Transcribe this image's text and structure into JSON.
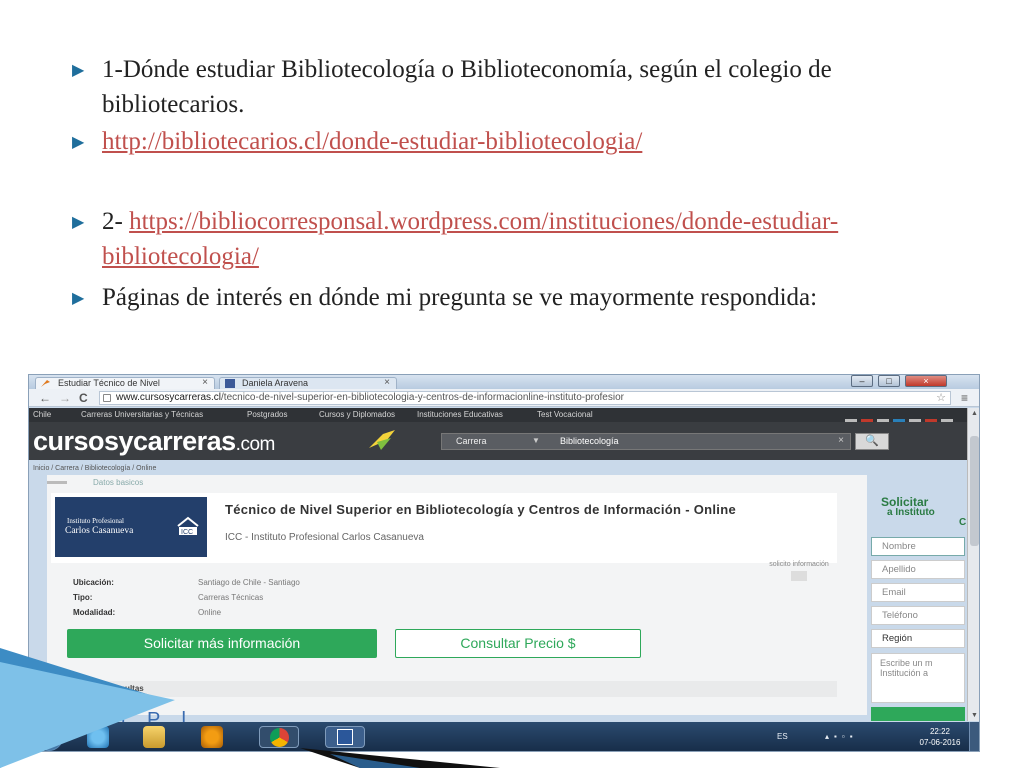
{
  "slide": {
    "bullets": [
      {
        "text": "1-Dónde estudiar Bibliotecología o Biblioteconomía, según el colegio de bibliotecarios."
      },
      {
        "link": "http://bibliotecarios.cl/donde-estudiar-bibliotecologia/"
      },
      {
        "prefix": "2- ",
        "link": "https://bibliocorresponsal.wordpress.com/instituciones/donde-estudiar-bibliotecologia/"
      },
      {
        "text": "Páginas de  interés en dónde mi pregunta se ve mayormente respondida:"
      }
    ],
    "accent_color": "#1f6e9c",
    "link_color": "#c0504d"
  },
  "browser": {
    "tabs": [
      {
        "label": "Estudiar Técnico de Nivel"
      },
      {
        "label": "Daniela Aravena"
      }
    ],
    "close_glyph": "×",
    "controls": {
      "min": "–",
      "max": "□",
      "close": "×"
    },
    "nav": {
      "back": "←",
      "forward": "→",
      "reload": "C"
    },
    "url_host": "www.cursosycarreras.cl",
    "url_path": "/tecnico-de-nivel-superior-en-bibliotecologia-y-centros-de-informacionline-instituto-profesior",
    "star": "☆",
    "menu": "≡"
  },
  "site": {
    "nav_items": [
      "Chile",
      "Carreras Universitarias y Técnicas",
      "Postgrados",
      "Cursos y Diplomados",
      "Instituciones Educativas",
      "Test Vocacional"
    ],
    "logo_main": "cursosycarreras",
    "logo_tld": ".com",
    "search": {
      "select": "Carrera",
      "value": "Bibliotecología",
      "clear": "×",
      "button": "🔍"
    },
    "breadcrumb": "Inicio / Carrera / Bibliotecología / Online",
    "section_tab": "Datos basicos",
    "institution_logo": {
      "line1": "Instituto Profesional",
      "line2": "Carlos Casanueva",
      "mark": "ICC"
    },
    "course_title": "Técnico de Nivel Superior en Bibliotecología y Centros de Información - Online",
    "course_institution": "ICC - Instituto Profesional Carlos Casanueva",
    "details": [
      {
        "label": "Ubicación:",
        "value": "Santiago de Chile - Santiago"
      },
      {
        "label": "Tipo:",
        "value": "Carreras Técnicas"
      },
      {
        "label": "Modalidad:",
        "value": "Online"
      }
    ],
    "request_info": "solicito información",
    "btn_request": "Solicitar más información",
    "btn_price": "Consultar Precio $",
    "recent_header": "Últimas Consultas",
    "bottom_cut": "E t l  P l",
    "sidebar": {
      "title1": "Solicitar",
      "title2": "a Instituto",
      "title3": "C",
      "fields": [
        "Nombre",
        "Apellido",
        "Email",
        "Teléfono",
        "Región"
      ],
      "message": "Escribe un m Institución a"
    },
    "brand_green": "#2ea85a"
  },
  "taskbar": {
    "lang": "ES",
    "time": "22:22",
    "date": "07-06-2016"
  }
}
